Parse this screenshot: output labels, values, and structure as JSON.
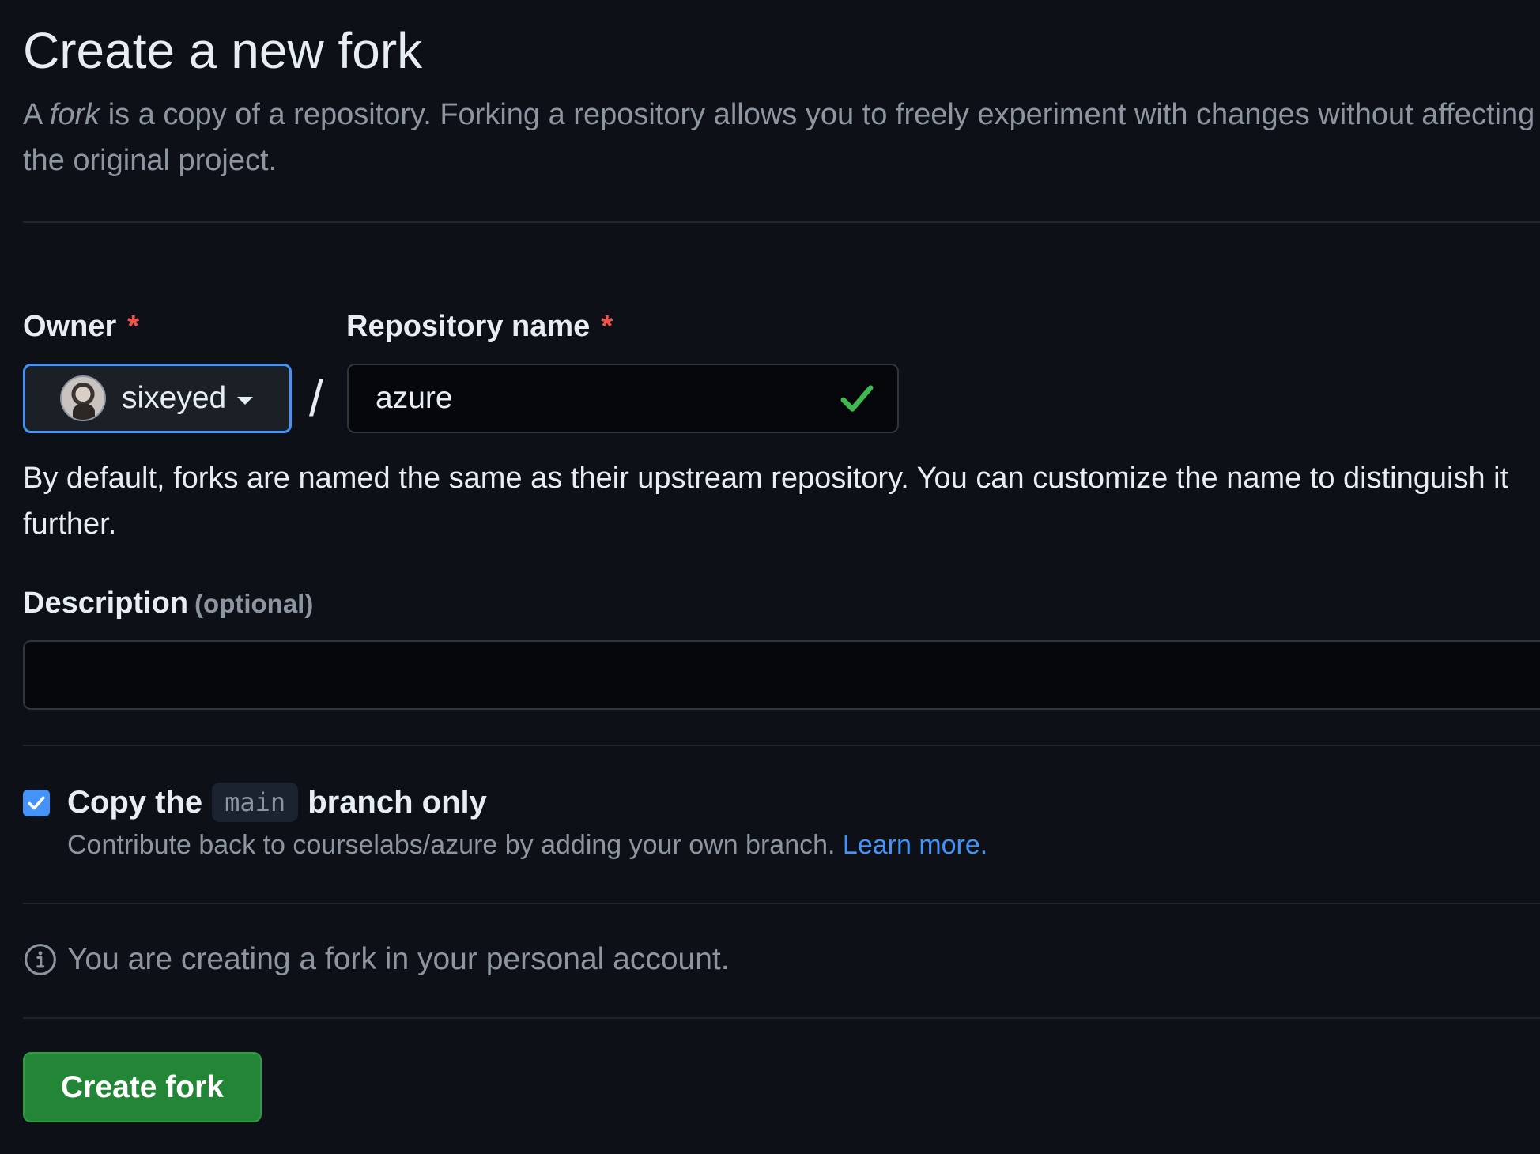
{
  "header": {
    "title": "Create a new fork",
    "subtitle_prefix": "A ",
    "subtitle_em": "fork",
    "subtitle_rest": " is a copy of a repository. Forking a repository allows you to freely experiment with changes without affecting the original project."
  },
  "owner": {
    "label": "Owner",
    "required_mark": "*",
    "selected": "sixeyed"
  },
  "separator": "/",
  "repository": {
    "label": "Repository name",
    "required_mark": "*",
    "value": "azure",
    "valid_icon": "check-icon",
    "valid_color": "#3fb950"
  },
  "helper_text": "By default, forks are named the same as their upstream repository. You can customize the name to distinguish it further.",
  "description": {
    "label": "Description",
    "optional_label": "(optional)",
    "value": "",
    "placeholder": ""
  },
  "copy_branch": {
    "checked": true,
    "label_before": "Copy the",
    "branch": "main",
    "label_after": "branch only",
    "help_text": "Contribute back to courselabs/azure by adding your own branch.",
    "learn_more": "Learn more."
  },
  "info": {
    "icon": "info-icon",
    "text": "You are creating a fork in your personal account."
  },
  "submit": {
    "label": "Create fork",
    "color": "#238636"
  },
  "colors": {
    "background": "#0d1117",
    "accent": "#4493f8",
    "required": "#f85149",
    "muted_text": "#8d96a0"
  }
}
